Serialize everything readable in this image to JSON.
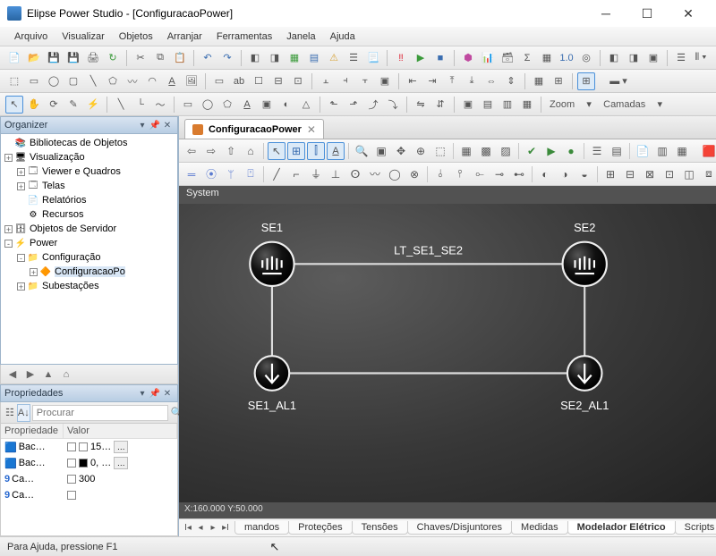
{
  "window": {
    "title": "Elipse Power Studio - [ConfiguracaoPower]"
  },
  "menus": [
    "Arquivo",
    "Visualizar",
    "Objetos",
    "Arranjar",
    "Ferramentas",
    "Janela",
    "Ajuda"
  ],
  "toolbar_zoom_label": "Zoom",
  "toolbar_layers_label": "Camadas",
  "organizer": {
    "title": "Organizer",
    "items": [
      {
        "level": 0,
        "tw": "",
        "icon": "📚",
        "label": "Bibliotecas de Objetos"
      },
      {
        "level": 0,
        "tw": "+",
        "icon": "🖥",
        "label": "Visualização"
      },
      {
        "level": 1,
        "tw": "+",
        "icon": "🗔",
        "label": "Viewer e Quadros"
      },
      {
        "level": 1,
        "tw": "+",
        "icon": "🗔",
        "label": "Telas"
      },
      {
        "level": 1,
        "tw": "",
        "icon": "📄",
        "label": "Relatórios"
      },
      {
        "level": 1,
        "tw": "",
        "icon": "⚙",
        "label": "Recursos"
      },
      {
        "level": 0,
        "tw": "+",
        "icon": "🗄",
        "label": "Objetos de Servidor"
      },
      {
        "level": 0,
        "tw": "-",
        "icon": "⚡",
        "label": "Power"
      },
      {
        "level": 1,
        "tw": "-",
        "icon": "📁",
        "label": "Configuração",
        "open": true
      },
      {
        "level": 2,
        "tw": "+",
        "icon": "🔶",
        "label": "ConfiguracaoPo",
        "sel": true
      },
      {
        "level": 1,
        "tw": "+",
        "icon": "📁",
        "label": "Subestações",
        "open": true
      }
    ]
  },
  "properties": {
    "title": "Propriedades",
    "search_placeholder": "Procurar",
    "headers": {
      "name": "Propriedade",
      "value": "Valor"
    },
    "rows": [
      {
        "icon": "🟦",
        "name": "Bac…",
        "chk": true,
        "swatch": "#ffffff",
        "value": "15…",
        "dots": true
      },
      {
        "icon": "🟦",
        "name": "Bac…",
        "chk": true,
        "swatch": "#000000",
        "value": "0, …",
        "dots": true
      },
      {
        "icon": "9",
        "name": "Ca…",
        "chk": true,
        "value": "300"
      },
      {
        "icon": "9",
        "name": "Ca…",
        "chk": true,
        "value": ""
      }
    ]
  },
  "document": {
    "tab_title": "ConfiguracaoPower",
    "system_label": "System",
    "nodes": {
      "se1": "SE1",
      "se2": "SE2",
      "se1_al1": "SE1_AL1",
      "se2_al1": "SE2_AL1",
      "line": "LT_SE1_SE2"
    },
    "coords": "X:160.000 Y:50.000"
  },
  "bottom_tabs": [
    "mandos",
    "Proteções",
    "Tensões",
    "Chaves/Disjuntores",
    "Medidas",
    "Modelador Elétrico",
    "Scripts"
  ],
  "bottom_active": 5,
  "status": "Para Ajuda, pressione F1"
}
